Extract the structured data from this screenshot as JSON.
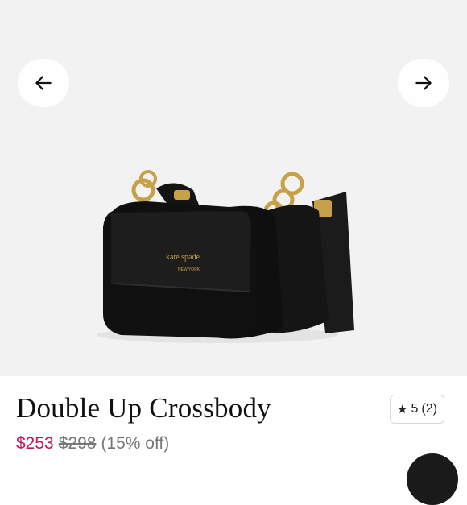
{
  "product": {
    "title": "Double Up Crossbody",
    "price_current": "$253",
    "price_original": "$298",
    "discount": "(15% off)",
    "image_brand_mark": "kate spade new york"
  },
  "rating": {
    "star_icon": "★",
    "value": "5",
    "count": "(2)"
  },
  "gallery": {
    "prev_icon": "arrow-left-icon",
    "next_icon": "arrow-right-icon"
  },
  "colors": {
    "sale_price": "#c2185b",
    "gallery_background": "#f2f2f2"
  }
}
